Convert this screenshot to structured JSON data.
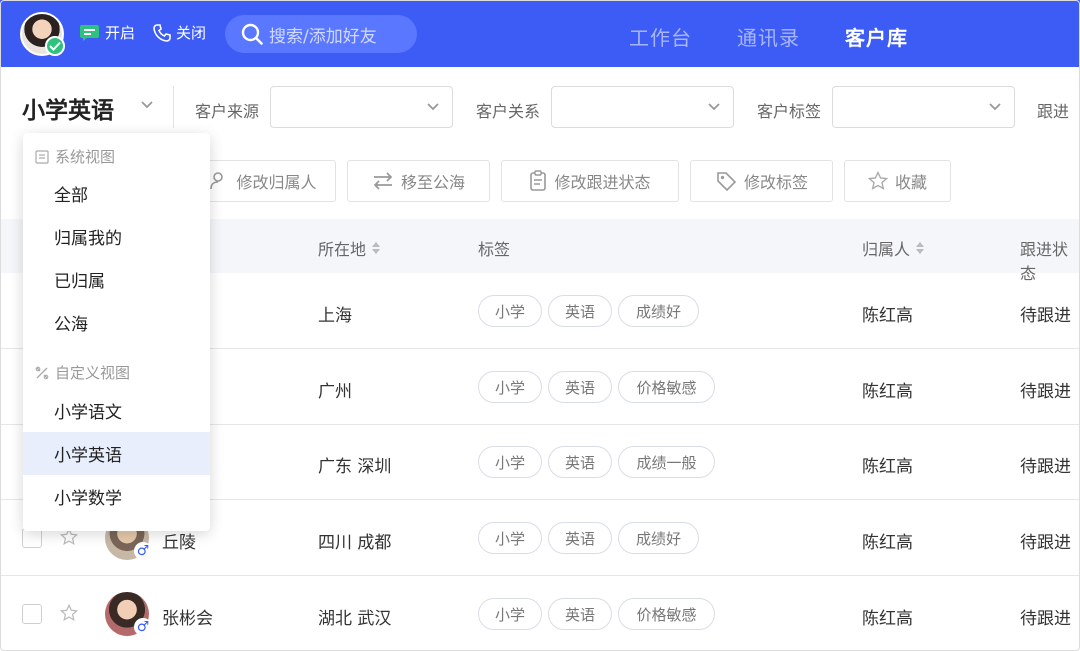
{
  "topbar": {
    "status_open": "开启",
    "status_close": "关闭",
    "search_placeholder": "搜索/添加好友",
    "tabs": [
      {
        "label": "工作台",
        "active": false
      },
      {
        "label": "通讯录",
        "active": false
      },
      {
        "label": "客户库",
        "active": true
      }
    ],
    "accent": "#3d5cf5"
  },
  "filters": {
    "current_view": "小学英语",
    "source_label": "客户来源",
    "relation_label": "客户关系",
    "tag_label": "客户标签",
    "followup_label": "跟进"
  },
  "actions": {
    "change_owner": "修改归属人",
    "move_to_pool": "移至公海",
    "change_followup": "修改跟进状态",
    "change_tags": "修改标签",
    "favorite": "收藏"
  },
  "table": {
    "headers": {
      "location": "所在地",
      "tags": "标签",
      "owner": "归属人",
      "followup": "跟进状态"
    },
    "rows": [
      {
        "name": "",
        "location": "上海",
        "tags": [
          "小学",
          "英语",
          "成绩好"
        ],
        "owner": "陈红高",
        "status": "待跟进"
      },
      {
        "name": "",
        "location": "广州",
        "tags": [
          "小学",
          "英语",
          "价格敏感"
        ],
        "owner": "陈红高",
        "status": "待跟进"
      },
      {
        "name": "",
        "location": "广东 深圳",
        "tags": [
          "小学",
          "英语",
          "成绩一般"
        ],
        "owner": "陈红高",
        "status": "待跟进"
      },
      {
        "name": "丘陵",
        "location": "四川 成都",
        "tags": [
          "小学",
          "英语",
          "成绩好"
        ],
        "owner": "陈红高",
        "status": "待跟进"
      },
      {
        "name": "张彬会",
        "location": "湖北 武汉",
        "tags": [
          "小学",
          "英语",
          "价格敏感"
        ],
        "owner": "陈红高",
        "status": "待跟进"
      }
    ]
  },
  "dropdown": {
    "system_group": "系统视图",
    "system_items": [
      "全部",
      "归属我的",
      "已归属",
      "公海"
    ],
    "custom_group": "自定义视图",
    "custom_items": [
      "小学语文",
      "小学英语",
      "小学数学"
    ],
    "selected": "小学英语"
  }
}
